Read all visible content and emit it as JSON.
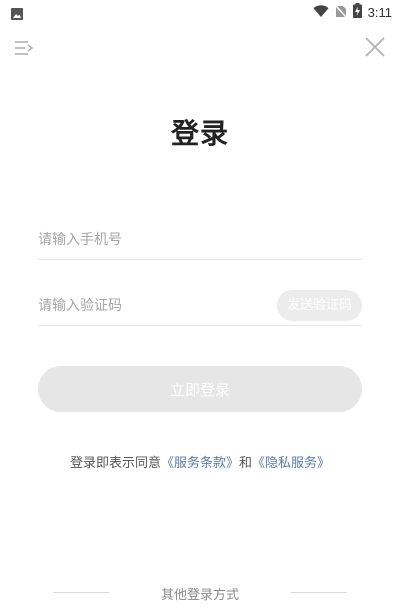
{
  "status_bar": {
    "time": "3:11",
    "icons": [
      "image-icon",
      "wifi-icon",
      "no-sim-icon",
      "battery-charging-icon"
    ]
  },
  "topbar": {
    "menu_icon": "menu-icon",
    "close_icon": "close-icon"
  },
  "page": {
    "title": "登录"
  },
  "form": {
    "phone_placeholder": "请输入手机号",
    "code_placeholder": "请输入验证码",
    "send_code_label": "发送验证码",
    "login_label": "立即登录"
  },
  "agreement": {
    "prefix": "登录即表示同意",
    "terms": "《服务条款》",
    "and": "和",
    "privacy": "《隐私服务》"
  },
  "other_login": {
    "label": "其他登录方式"
  },
  "colors": {
    "link": "#5a7aa6",
    "disabled_button": "#e6e6e6",
    "placeholder": "#a6a6a6"
  }
}
